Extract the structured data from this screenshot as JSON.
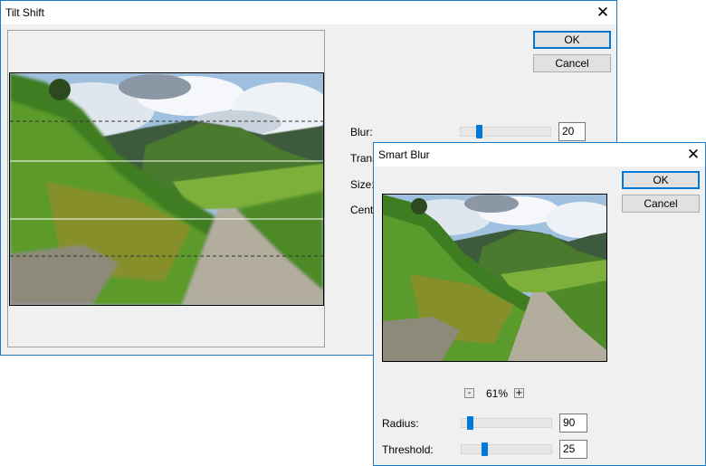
{
  "tilt_shift": {
    "title": "Tilt Shift",
    "ok_label": "OK",
    "cancel_label": "Cancel",
    "blur_label": "Blur:",
    "blur_value": "20",
    "transition_label": "Trans",
    "size_label": "Size:",
    "center_label": "Cent"
  },
  "smart_blur": {
    "title": "Smart Blur",
    "ok_label": "OK",
    "cancel_label": "Cancel",
    "zoom_out_label": "-",
    "zoom_in_label": "+",
    "zoom_level": "61%",
    "radius_label": "Radius:",
    "radius_value": "90",
    "threshold_label": "Threshold:",
    "threshold_value": "25"
  },
  "icons": {
    "close": "close-icon"
  },
  "colors": {
    "accent": "#0078d7",
    "window_border": "#1979ca",
    "dialog_bg": "#f0f0f0"
  }
}
